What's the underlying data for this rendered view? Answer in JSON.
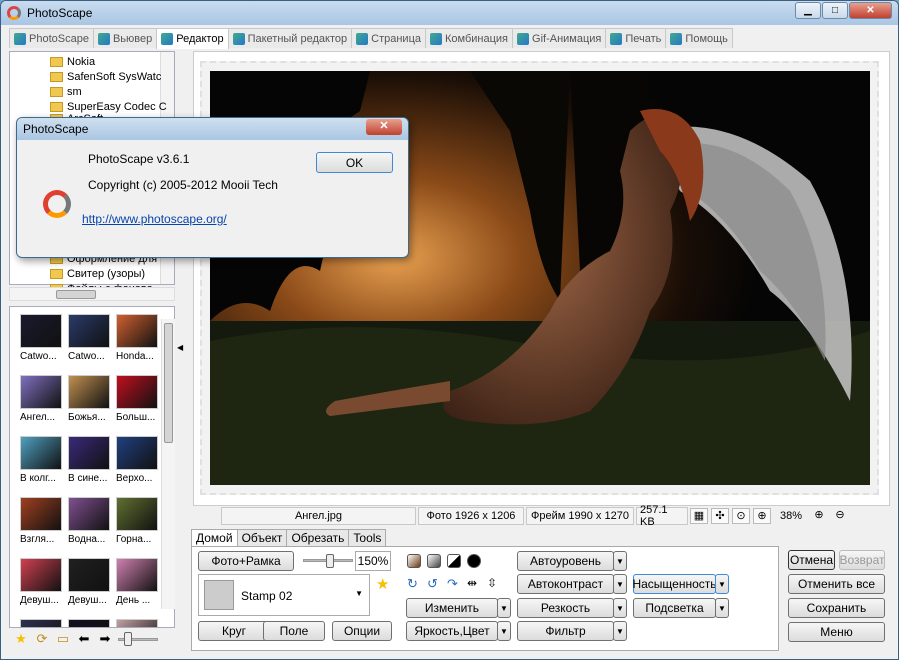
{
  "window": {
    "title": "PhotoScape"
  },
  "tabs": [
    {
      "label": "PhotoScape",
      "active": false
    },
    {
      "label": "Вьювер",
      "active": false
    },
    {
      "label": "Редактор",
      "active": true
    },
    {
      "label": "Пакетный редактор",
      "active": false
    },
    {
      "label": "Страница",
      "active": false
    },
    {
      "label": "Комбинация",
      "active": false
    },
    {
      "label": "Gif-Анимация",
      "active": false
    },
    {
      "label": "Печать",
      "active": false
    },
    {
      "label": "Помощь",
      "active": false
    }
  ],
  "tree": {
    "items": [
      "Nokia",
      "SafenSoft SysWatc",
      "sm",
      "SuperEasy Codec C",
      "ArcSoft",
      "Оформление для",
      "Свитер (узоры)",
      "Файлы с фоново"
    ]
  },
  "thumbnails": [
    {
      "label": "Catwo...",
      "color": "#1a1a2e"
    },
    {
      "label": "Catwo...",
      "color": "#2a3a6a"
    },
    {
      "label": "Honda...",
      "color": "#d06030"
    },
    {
      "label": "Ангел...",
      "color": "#8070c0"
    },
    {
      "label": "Божья...",
      "color": "#c09050"
    },
    {
      "label": "Больш...",
      "color": "#c01020"
    },
    {
      "label": "В колг...",
      "color": "#50a0c0"
    },
    {
      "label": "В сине...",
      "color": "#3a2a7a"
    },
    {
      "label": "Верхо...",
      "color": "#204080"
    },
    {
      "label": "Взгля...",
      "color": "#a04020"
    },
    {
      "label": "Водна...",
      "color": "#805090"
    },
    {
      "label": "Горна...",
      "color": "#607030"
    },
    {
      "label": "Девуш...",
      "color": "#d04050"
    },
    {
      "label": "Девуш...",
      "color": "#202020"
    },
    {
      "label": "День ...",
      "color": "#d080b0"
    },
    {
      "label": "",
      "color": "#303050"
    },
    {
      "label": "",
      "color": "#101020"
    },
    {
      "label": "",
      "color": "#c0a0a0"
    }
  ],
  "bottom_icons": [
    "star-icon",
    "refresh-icon",
    "folder-icon",
    "back-icon",
    "forward-icon"
  ],
  "status": {
    "filename": "Ангел.jpg",
    "photo_size": "Фото 1926 x 1206",
    "frame_size": "Фрейм 1990 x 1270",
    "file_size": "257.1 KB",
    "zoom": "38%"
  },
  "panel_tabs": [
    {
      "label": "Домой",
      "active": true
    },
    {
      "label": "Объект",
      "active": false
    },
    {
      "label": "Обрезать",
      "active": false
    },
    {
      "label": "Tools",
      "active": false
    }
  ],
  "panel": {
    "photo_frame_btn": "Фото+Рамка",
    "scale_value": "150%",
    "scale_fraction": 0.55,
    "frame_combo": "Stamp 02",
    "circle_btn": "Круг",
    "field_btn": "Поле",
    "options_btn": "Опции",
    "auto_level": "Автоуровень",
    "auto_contrast": "Автоконтраст",
    "saturation": "Насыщенность",
    "change": "Изменить",
    "sharpness": "Резкость",
    "backlight": "Подсветка",
    "brightness": "Яркость,Цвет",
    "filter": "Фильтр"
  },
  "right_buttons": {
    "undo": "Отмена",
    "redo": "Возврат",
    "undo_all": "Отменить все",
    "save": "Сохранить",
    "menu": "Меню"
  },
  "dialog": {
    "title": "PhotoScape",
    "version": "PhotoScape v3.6.1",
    "copyright": "Copyright (c) 2005-2012 Mooii Tech",
    "url": "http://www.photoscape.org/",
    "ok": "OK"
  }
}
